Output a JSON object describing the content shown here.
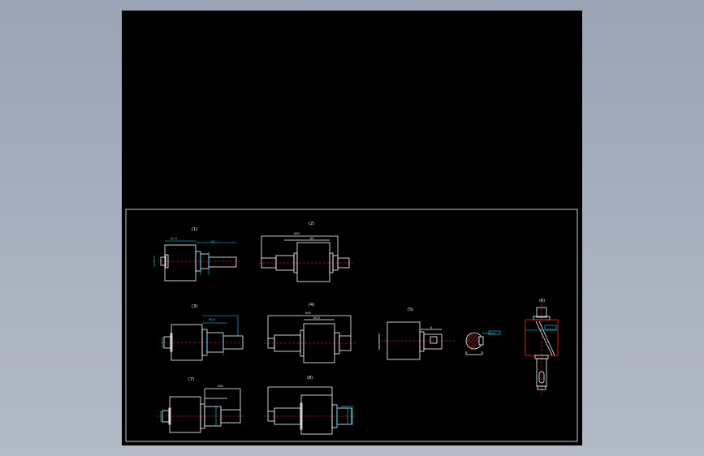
{
  "viewport": {
    "background": "#000000",
    "page_background": "#a8b0bd"
  },
  "colors": {
    "outline": "#ffffff",
    "dimension": "#00e5ff",
    "centerline": "#ff2020"
  },
  "views": [
    {
      "id": "view-1",
      "label": "(1)"
    },
    {
      "id": "view-2",
      "label": "(2)"
    },
    {
      "id": "view-3",
      "label": "(3)"
    },
    {
      "id": "view-4",
      "label": "(4)"
    },
    {
      "id": "view-5",
      "label": "(5)"
    },
    {
      "id": "view-6",
      "label": "(6)"
    },
    {
      "id": "view-7",
      "label": "(7)"
    },
    {
      "id": "view-8",
      "label": "(8)"
    }
  ]
}
